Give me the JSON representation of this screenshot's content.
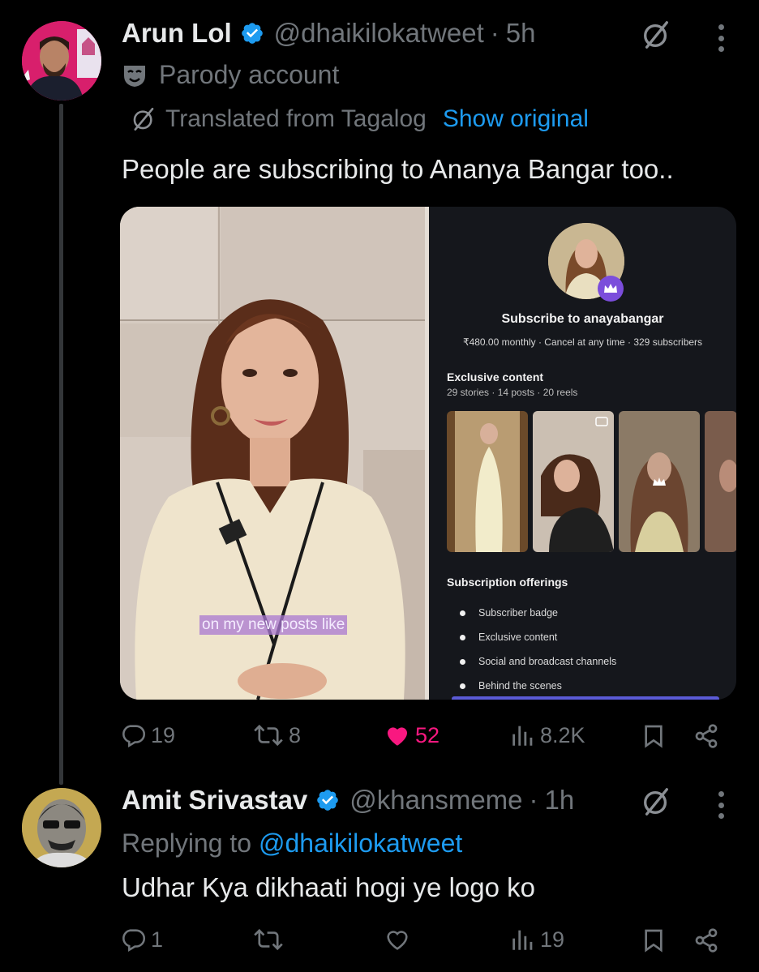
{
  "tweet": {
    "author_name": "Arun Lol",
    "handle": "@dhaikilokatweet",
    "separator": "·",
    "time": "5h",
    "parody_label": "Parody account",
    "translated_label": "Translated from Tagalog",
    "show_original": "Show original",
    "text": "People are subscribing to Ananya Bangar too..",
    "media": {
      "caption": "on my new posts like",
      "subscribe_title": "Subscribe to anayabangar",
      "subscribe_meta": "₹480.00 monthly · Cancel at any time · 329 subscribers",
      "exclusive_title": "Exclusive content",
      "exclusive_meta": "29 stories · 14 posts · 20 reels",
      "offerings_title": "Subscription offerings",
      "offerings": [
        "Subscriber badge",
        "Exclusive content",
        "Social and broadcast channels",
        "Behind the scenes"
      ]
    },
    "stats": {
      "replies": "19",
      "reposts": "8",
      "likes": "52",
      "views": "8.2K"
    }
  },
  "reply": {
    "author_name": "Amit Srivastav",
    "handle": "@khansmeme",
    "separator": "·",
    "time": "1h",
    "replying_to_label": "Replying to",
    "replying_to_handle": "@dhaikilokatweet",
    "text": "Udhar Kya dikhaati hogi ye logo ko",
    "stats": {
      "replies": "1",
      "reposts": "",
      "likes": "",
      "views": "19"
    }
  },
  "colors": {
    "background": "#000000",
    "text_primary": "#e7e9ea",
    "text_secondary": "#71767b",
    "link": "#1d9bf0",
    "like": "#f91880",
    "verified": "#1d9bf0"
  },
  "icons": [
    "verified-badge-icon",
    "grok-icon",
    "more-icon",
    "parody-mask-icon",
    "translate-icon",
    "reply-icon",
    "repost-icon",
    "like-icon",
    "views-icon",
    "bookmark-icon",
    "share-icon"
  ]
}
